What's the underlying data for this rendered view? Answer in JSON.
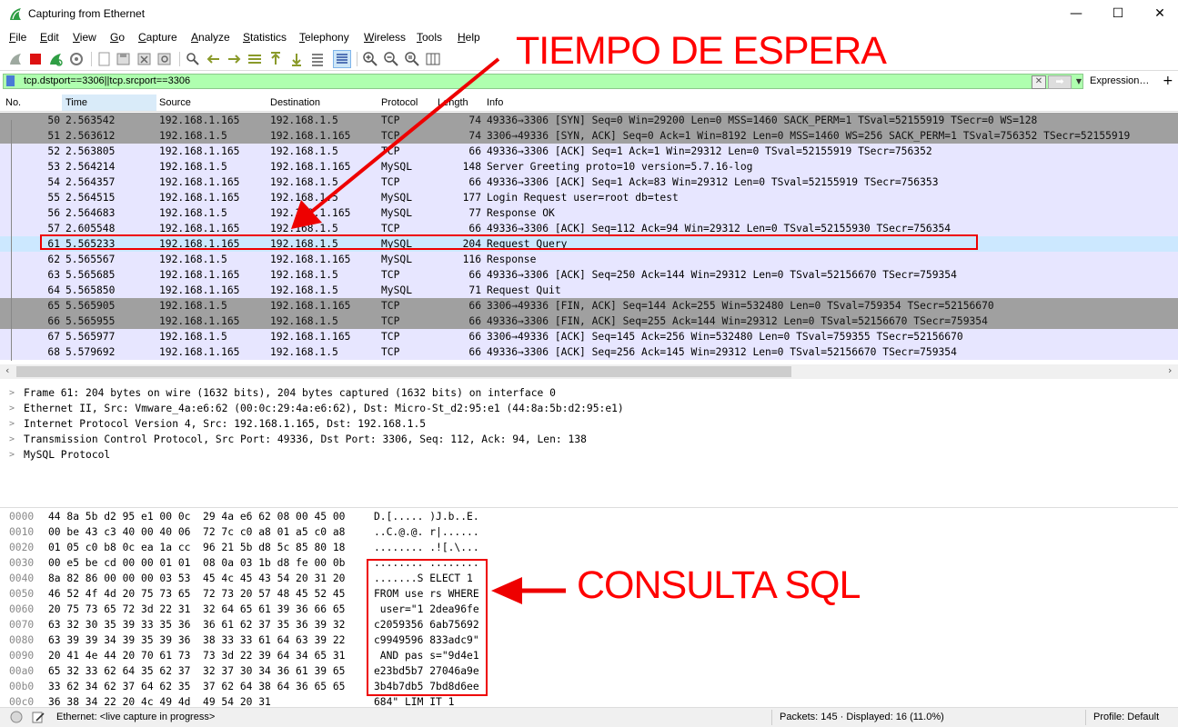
{
  "window": {
    "title": "Capturing from Ethernet",
    "minimize": "—",
    "maximize": "☐",
    "close": "✕"
  },
  "menu": [
    "File",
    "Edit",
    "View",
    "Go",
    "Capture",
    "Analyze",
    "Statistics",
    "Telephony",
    "Wireless",
    "Tools",
    "Help"
  ],
  "filter": {
    "value": "tcp.dstport==3306||tcp.srcport==3306",
    "expression_label": "Expression…",
    "plus": "+",
    "clear": "✕",
    "apply": "➡",
    "dropdown": "▼"
  },
  "columns": [
    "No.",
    "Time",
    "Source",
    "Destination",
    "Protocol",
    "Length",
    "Info"
  ],
  "packets": [
    {
      "no": "50",
      "time": "2.563542",
      "src": "192.168.1.165",
      "dst": "192.168.1.5",
      "proto": "TCP",
      "len": "74",
      "info": "49336→3306 [SYN] Seq=0 Win=29200 Len=0 MSS=1460 SACK_PERM=1 TSval=52155919 TSecr=0 WS=128",
      "style": "gray"
    },
    {
      "no": "51",
      "time": "2.563612",
      "src": "192.168.1.5",
      "dst": "192.168.1.165",
      "proto": "TCP",
      "len": "74",
      "info": "3306→49336 [SYN, ACK] Seq=0 Ack=1 Win=8192 Len=0 MSS=1460 WS=256 SACK_PERM=1 TSval=756352 TSecr=52155919",
      "style": "gray"
    },
    {
      "no": "52",
      "time": "2.563805",
      "src": "192.168.1.165",
      "dst": "192.168.1.5",
      "proto": "TCP",
      "len": "66",
      "info": "49336→3306 [ACK] Seq=1 Ack=1 Win=29312 Len=0 TSval=52155919 TSecr=756352",
      "style": "lav"
    },
    {
      "no": "53",
      "time": "2.564214",
      "src": "192.168.1.5",
      "dst": "192.168.1.165",
      "proto": "MySQL",
      "len": "148",
      "info": "Server Greeting proto=10 version=5.7.16-log",
      "style": "lav"
    },
    {
      "no": "54",
      "time": "2.564357",
      "src": "192.168.1.165",
      "dst": "192.168.1.5",
      "proto": "TCP",
      "len": "66",
      "info": "49336→3306 [ACK] Seq=1 Ack=83 Win=29312 Len=0 TSval=52155919 TSecr=756353",
      "style": "lav"
    },
    {
      "no": "55",
      "time": "2.564515",
      "src": "192.168.1.165",
      "dst": "192.168.1.5",
      "proto": "MySQL",
      "len": "177",
      "info": "Login Request user=root db=test",
      "style": "lav"
    },
    {
      "no": "56",
      "time": "2.564683",
      "src": "192.168.1.5",
      "dst": "192.168.1.165",
      "proto": "MySQL",
      "len": "77",
      "info": "Response OK",
      "style": "lav"
    },
    {
      "no": "57",
      "time": "2.605548",
      "src": "192.168.1.165",
      "dst": "192.168.1.5",
      "proto": "TCP",
      "len": "66",
      "info": "49336→3306 [ACK] Seq=112 Ack=94 Win=29312 Len=0 TSval=52155930 TSecr=756354",
      "style": "lav"
    },
    {
      "no": "61",
      "time": "5.565233",
      "src": "192.168.1.165",
      "dst": "192.168.1.5",
      "proto": "MySQL",
      "len": "204",
      "info": "Request Query",
      "style": "sel"
    },
    {
      "no": "62",
      "time": "5.565567",
      "src": "192.168.1.5",
      "dst": "192.168.1.165",
      "proto": "MySQL",
      "len": "116",
      "info": "Response",
      "style": "lav"
    },
    {
      "no": "63",
      "time": "5.565685",
      "src": "192.168.1.165",
      "dst": "192.168.1.5",
      "proto": "TCP",
      "len": "66",
      "info": "49336→3306 [ACK] Seq=250 Ack=144 Win=29312 Len=0 TSval=52156670 TSecr=759354",
      "style": "lav"
    },
    {
      "no": "64",
      "time": "5.565850",
      "src": "192.168.1.165",
      "dst": "192.168.1.5",
      "proto": "MySQL",
      "len": "71",
      "info": "Request Quit",
      "style": "lav"
    },
    {
      "no": "65",
      "time": "5.565905",
      "src": "192.168.1.5",
      "dst": "192.168.1.165",
      "proto": "TCP",
      "len": "66",
      "info": "3306→49336 [FIN, ACK] Seq=144 Ack=255 Win=532480 Len=0 TSval=759354 TSecr=52156670",
      "style": "gray"
    },
    {
      "no": "66",
      "time": "5.565955",
      "src": "192.168.1.165",
      "dst": "192.168.1.5",
      "proto": "TCP",
      "len": "66",
      "info": "49336→3306 [FIN, ACK] Seq=255 Ack=144 Win=29312 Len=0 TSval=52156670 TSecr=759354",
      "style": "gray"
    },
    {
      "no": "67",
      "time": "5.565977",
      "src": "192.168.1.5",
      "dst": "192.168.1.165",
      "proto": "TCP",
      "len": "66",
      "info": "3306→49336 [ACK] Seq=145 Ack=256 Win=532480 Len=0 TSval=759355 TSecr=52156670",
      "style": "lav"
    },
    {
      "no": "68",
      "time": "5.579692",
      "src": "192.168.1.165",
      "dst": "192.168.1.5",
      "proto": "TCP",
      "len": "66",
      "info": "49336→3306 [ACK] Seq=256 Ack=145 Win=29312 Len=0 TSval=52156670 TSecr=759354",
      "style": "lav"
    }
  ],
  "details": [
    "Frame 61: 204 bytes on wire (1632 bits), 204 bytes captured (1632 bits) on interface 0",
    "Ethernet II, Src: Vmware_4a:e6:62 (00:0c:29:4a:e6:62), Dst: Micro-St_d2:95:e1 (44:8a:5b:d2:95:e1)",
    "Internet Protocol Version 4, Src: 192.168.1.165, Dst: 192.168.1.5",
    "Transmission Control Protocol, Src Port: 49336, Dst Port: 3306, Seq: 112, Ack: 94, Len: 138",
    "MySQL Protocol"
  ],
  "bytes": [
    {
      "off": "0000",
      "hex": "44 8a 5b d2 95 e1 00 0c  29 4a e6 62 08 00 45 00",
      "ascii": "D.[..... )J.b..E."
    },
    {
      "off": "0010",
      "hex": "00 be 43 c3 40 00 40 06  72 7c c0 a8 01 a5 c0 a8",
      "ascii": "..C.@.@. r|......"
    },
    {
      "off": "0020",
      "hex": "01 05 c0 b8 0c ea 1a cc  96 21 5b d8 5c 85 80 18",
      "ascii": "........ .![.\\..."
    },
    {
      "off": "0030",
      "hex": "00 e5 be cd 00 00 01 01  08 0a 03 1b d8 fe 00 0b",
      "ascii": "........ ........"
    },
    {
      "off": "0040",
      "hex": "8a 82 86 00 00 00 03 53  45 4c 45 43 54 20 31 20",
      "ascii": ".......S ELECT 1 "
    },
    {
      "off": "0050",
      "hex": "46 52 4f 4d 20 75 73 65  72 73 20 57 48 45 52 45",
      "ascii": "FROM use rs WHERE"
    },
    {
      "off": "0060",
      "hex": "20 75 73 65 72 3d 22 31  32 64 65 61 39 36 66 65",
      "ascii": " user=\"1 2dea96fe"
    },
    {
      "off": "0070",
      "hex": "63 32 30 35 39 33 35 36  36 61 62 37 35 36 39 32",
      "ascii": "c2059356 6ab75692"
    },
    {
      "off": "0080",
      "hex": "63 39 39 34 39 35 39 36  38 33 33 61 64 63 39 22",
      "ascii": "c9949596 833adc9\""
    },
    {
      "off": "0090",
      "hex": "20 41 4e 44 20 70 61 73  73 3d 22 39 64 34 65 31",
      "ascii": " AND pas s=\"9d4e1"
    },
    {
      "off": "00a0",
      "hex": "65 32 33 62 64 35 62 37  32 37 30 34 36 61 39 65",
      "ascii": "e23bd5b7 27046a9e"
    },
    {
      "off": "00b0",
      "hex": "33 62 34 62 37 64 62 35  37 62 64 38 64 36 65 65",
      "ascii": "3b4b7db5 7bd8d6ee"
    },
    {
      "off": "00c0",
      "hex": "36 38 34 22 20 4c 49 4d  49 54 20 31",
      "ascii": "684\" LIM IT 1"
    }
  ],
  "status": {
    "capture": "Ethernet: <live capture in progress>",
    "packets": "Packets: 145 · Displayed: 16 (11.0%)",
    "profile": "Profile: Default"
  },
  "annotations": {
    "wait": "TIEMPO DE ESPERA",
    "query": "CONSULTA SQL"
  },
  "colors": {
    "accent": "#ff0000",
    "filter_ok": "#afffaf",
    "selected": "#cce8ff",
    "row_gray": "#a0a0a0",
    "row_lavender": "#e7e6ff"
  }
}
